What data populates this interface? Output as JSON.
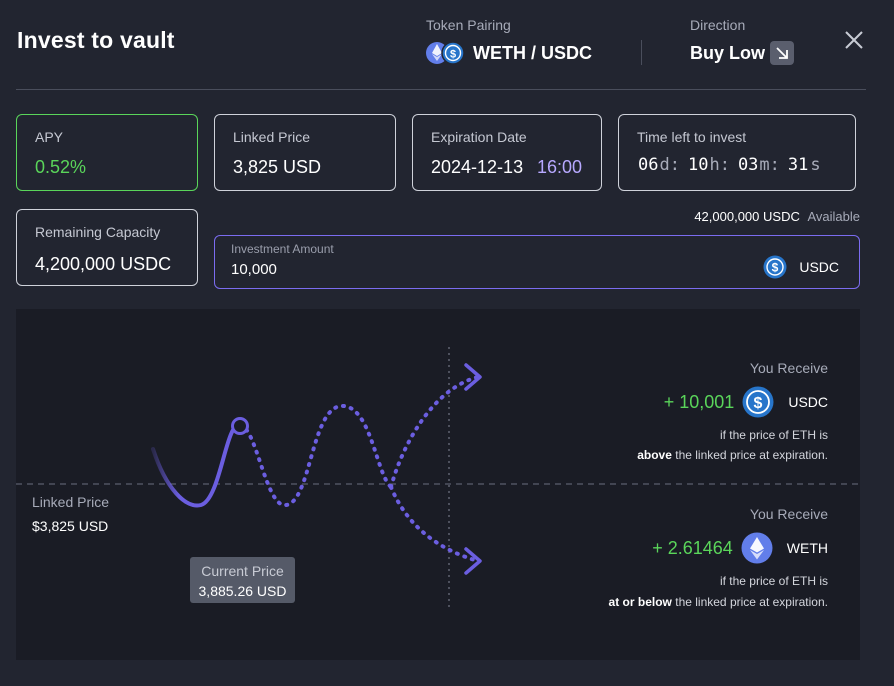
{
  "header": {
    "title": "Invest to vault",
    "token_pairing_label": "Token Pairing",
    "token_pairing_value": "WETH / USDC",
    "direction_label": "Direction",
    "direction_value": "Buy Low"
  },
  "stats": {
    "apy_label": "APY",
    "apy_value": "0.52%",
    "linked_price_label": "Linked Price",
    "linked_price_value": "3,825 USD",
    "expiration_label": "Expiration Date",
    "expiration_date": "2024-12-13",
    "expiration_time": "16:00",
    "time_left_label": "Time left to invest",
    "time_left": {
      "days": "06",
      "hours": "10",
      "minutes": "03",
      "seconds": "31",
      "d": "d:",
      "h": "h:",
      "m": "m:",
      "s": "s"
    },
    "remaining_capacity_label": "Remaining Capacity",
    "remaining_capacity_value": "4,200,000 USDC"
  },
  "investment": {
    "available_amount": "42,000,000 USDC",
    "available_label": "Available",
    "amount_label": "Investment Amount",
    "amount_value": "10,000",
    "currency": "USDC"
  },
  "payoff": {
    "linked_price_label": "Linked Price",
    "linked_price_value": "$3,825 USD",
    "current_price_label": "Current Price",
    "current_price_value": "3,885.26 USD",
    "upper": {
      "label": "You Receive",
      "amount": "+ 10,001",
      "currency": "USDC",
      "cond_line1": "if the price of ETH is",
      "cond_bold": "above",
      "cond_rest": "the linked price at expiration."
    },
    "lower": {
      "label": "You Receive",
      "amount": "+ 2.61464",
      "currency": "WETH",
      "cond_line1": "if the price of ETH is",
      "cond_bold": "at or below",
      "cond_rest": "the linked price at expiration."
    }
  },
  "colors": {
    "accent": "#7b6cf0",
    "positive": "#5ad55a",
    "usdc": "#2775ca",
    "eth": "#627eea"
  },
  "icons": [
    "weth-icon",
    "usdc-icon",
    "arrow-down-right-icon",
    "close-icon"
  ]
}
